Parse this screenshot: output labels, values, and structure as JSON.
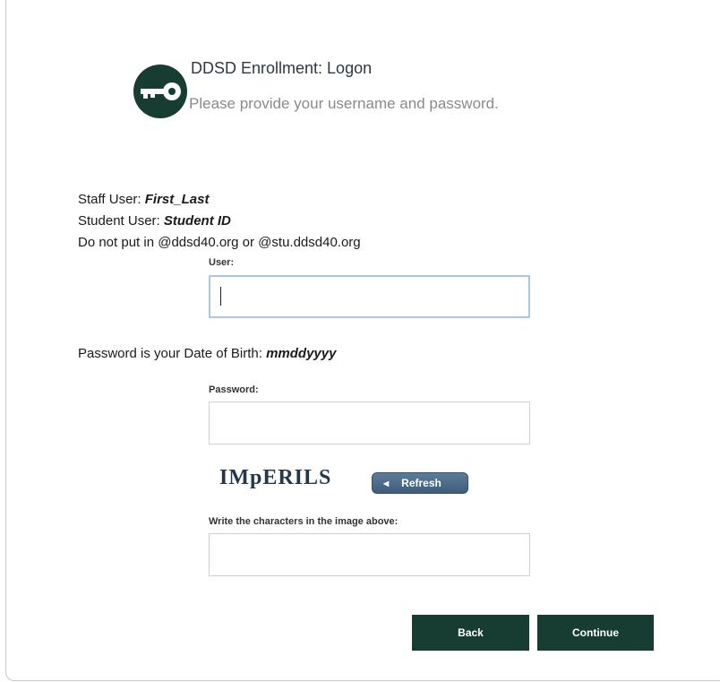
{
  "header": {
    "title": "DDSD Enrollment: Logon",
    "subtitle": "Please provide your username and password.",
    "icon": "key-icon"
  },
  "instructions": {
    "staff_prefix": "Staff User: ",
    "staff_hint": "First_Last",
    "student_prefix": "Student User: ",
    "student_hint": "Student ID",
    "domain_note": "Do not put in @ddsd40.org or @stu.ddsd40.org",
    "password_prefix": "Password is your Date of Birth: ",
    "password_hint": "mmddyyyy"
  },
  "form": {
    "user_label": "User:",
    "user_value": "",
    "password_label": "Password:",
    "password_value": "",
    "captcha_text": "IMpERILS",
    "refresh_label": "Refresh",
    "captcha_label": "Write the characters in the image above:",
    "captcha_value": ""
  },
  "actions": {
    "back_label": "Back",
    "continue_label": "Continue"
  },
  "colors": {
    "brand_dark_green": "#173d33",
    "refresh_blue": "#4a6a88",
    "focus_border": "#a9c6e6"
  }
}
